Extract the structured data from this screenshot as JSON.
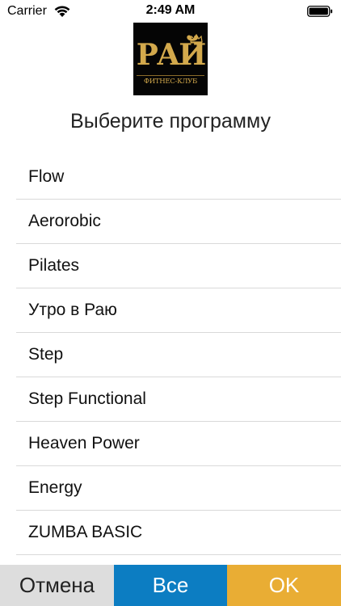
{
  "status_bar": {
    "carrier": "Carrier",
    "time": "2:49 AM",
    "icons": [
      "wifi-icon",
      "battery-icon"
    ]
  },
  "logo": {
    "word": "РАЙ",
    "subtitle": "ФИТНЕС-КЛУБ",
    "colors": {
      "background": "#050505",
      "gold": "#d3a94c"
    }
  },
  "header": {
    "title": "Выберите программу"
  },
  "programs": [
    "Flow",
    "Aerorobic",
    "Pilates",
    "Утро в Раю",
    "Step",
    "Step Functional",
    "Heaven Power",
    "Energy",
    "ZUMBA BASIC"
  ],
  "buttons": {
    "cancel": "Отмена",
    "all": "Все",
    "ok": "OK"
  },
  "colors": {
    "cancel_bg": "#dddddd",
    "all_bg": "#0c7dc2",
    "ok_bg": "#e9ad34",
    "divider": "#d9d9d9"
  }
}
